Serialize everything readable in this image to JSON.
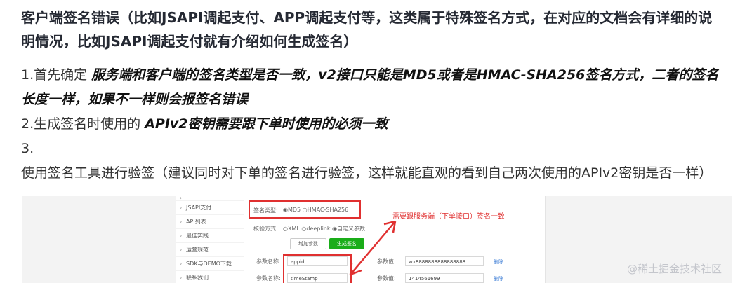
{
  "heading": "客户端签名错误（比如JSAPI调起支付、APP调起支付等，这类属于特殊签名方式，在对应的文档会有详细的说明情况，比如JSAPI调起支付就有介绍如何生成签名）",
  "items": [
    {
      "num": "1.",
      "plain": "首先确定 ",
      "bold": "服务端和客户端的签名类型是否一致，v2接口只能是MD5或者是HMAC-SHA256签名方式，二者的签名长度一样，如果不一样则会报签名错误"
    },
    {
      "num": "2.",
      "plain": "生成签名时使用的 ",
      "bold": "APIv2密钥需要跟下单时使用的必须一致"
    },
    {
      "num": "3.",
      "plain": "使用签名工具进行验签（建议同时对下单的签名进行验签，这样就能直观的看到自己两次使用的APIv2密钥是否一样）",
      "bold": ""
    }
  ],
  "screenshot": {
    "sidebar": [
      "JSAPI支付",
      "API列表",
      "最佳实践",
      "运营规范",
      "SDK与DEMO下载",
      "联系我们"
    ],
    "sign_type_label": "签名类型:",
    "sign_type_options": "◉MD5 ○HMAC-SHA256",
    "check_label": "校验方式:",
    "check_options": "○XML ○deeplink ◉自定义参数",
    "btn_add": "增加参数",
    "btn_generate": "生成签名",
    "param_name_label": "参数名称:",
    "param_value_label": "参数值:",
    "params": [
      {
        "name": "appid",
        "value": "wx8888888888888888",
        "action": "删除"
      },
      {
        "name": "timeStamp",
        "value": "1414561699",
        "action": "删除"
      }
    ],
    "note": "需要跟服务端（下单接口）签名一致"
  },
  "watermark": "@稀土掘金技术社区"
}
